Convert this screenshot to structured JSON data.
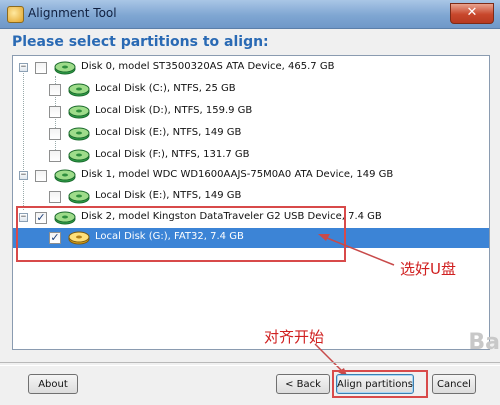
{
  "window": {
    "title": "Alignment Tool",
    "close_glyph": "✕"
  },
  "heading": "Please select partitions to align:",
  "tree": {
    "disks": [
      {
        "label": "Disk 0, model ST3500320AS ATA Device, 465.7 GB",
        "checked": false,
        "partitions": [
          {
            "label": "Local Disk (C:), NTFS, 25 GB",
            "checked": false
          },
          {
            "label": "Local Disk (D:), NTFS, 159.9 GB",
            "checked": false
          },
          {
            "label": "Local Disk (E:), NTFS, 149 GB",
            "checked": false
          },
          {
            "label": "Local Disk (F:), NTFS, 131.7 GB",
            "checked": false
          }
        ]
      },
      {
        "label": "Disk 1, model WDC WD1600AAJS-75M0A0 ATA Device, 149 GB",
        "checked": false,
        "partitions": [
          {
            "label": "Local Disk (E:), NTFS, 149 GB",
            "checked": false
          }
        ]
      },
      {
        "label": "Disk 2, model Kingston DataTraveler G2 USB Device, 7.4 GB",
        "checked": true,
        "partitions": [
          {
            "label": "Local Disk (G:), FAT32, 7.4 GB",
            "checked": true,
            "selected": true
          }
        ]
      }
    ]
  },
  "annotations": {
    "select_usb": "选好U盘",
    "start_align": "对齐开始"
  },
  "buttons": {
    "about": "About",
    "back": "< Back",
    "align": "Align partitions",
    "cancel": "Cancel"
  },
  "watermark": "Ba",
  "colors": {
    "accent": "#2a6ab4",
    "selection": "#3c84d6",
    "annotation": "#d84a4a"
  },
  "icons": {
    "disk": "disk-drive-icon",
    "usb": "usb-drive-icon"
  }
}
